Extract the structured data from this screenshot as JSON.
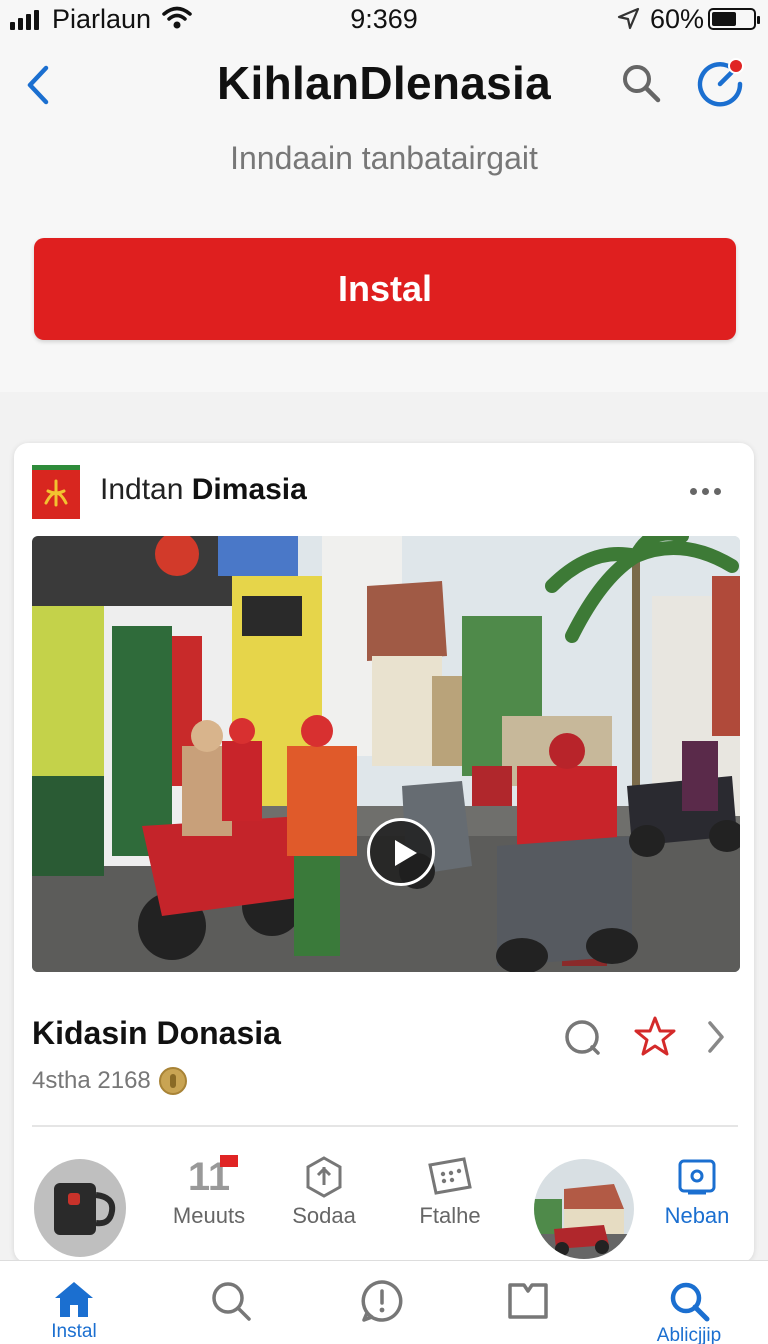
{
  "status": {
    "carrier": "Piarlaun",
    "time": "9:369",
    "battery": "60%",
    "battery_level": 0.6
  },
  "header": {
    "title": "KihlanDlenasia",
    "subtitle": "Inndaain tanbatairgait",
    "install_label": "Instal"
  },
  "card": {
    "brand_prefix": "Indtan",
    "brand_name": "Dimasia",
    "app_name": "Kidasin Donasia",
    "app_meta": "4stha 2168"
  },
  "features": [
    {
      "value": "11",
      "label": "Meuuts"
    },
    {
      "label": "Sodaa"
    },
    {
      "label": "Ftalhe"
    },
    {
      "label": "Neban"
    }
  ],
  "tabs": [
    {
      "label": "Instal"
    },
    {
      "label": ""
    },
    {
      "label": ""
    },
    {
      "label": ""
    },
    {
      "label": "Ablicjjip"
    }
  ],
  "colors": {
    "accent": "#1b6fd0",
    "install": "#df1f1f"
  }
}
